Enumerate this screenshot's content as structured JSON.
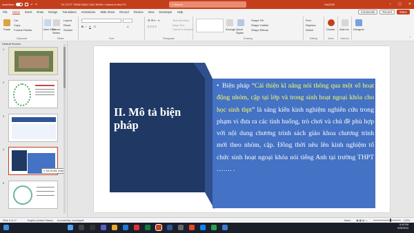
{
  "titlebar": {
    "autosave_label": "AutoSave",
    "toggle_state": "Off",
    "file_name": "TH CVTT TRINH BAO CAO SKKN • Saved to this PC",
    "search_placeholder": "Search",
    "user_name": "Hiu2220",
    "colors": {
      "accent": "#c43e1c"
    }
  },
  "tabs": [
    "File",
    "Home",
    "Insert",
    "Draw",
    "Design",
    "Transitions",
    "Animations",
    "Slide Show",
    "Record",
    "Review",
    "View",
    "Developer",
    "Help"
  ],
  "active_tab": "Home",
  "tab_actions": {
    "comments": "Comments",
    "record": "Record",
    "share": "Share"
  },
  "ribbon": {
    "clipboard": {
      "paste": "Paste",
      "cut": "Cut",
      "copy": "Copy",
      "format_painter": "Format Painter",
      "label": "Clipboard"
    },
    "slides": {
      "new_slide": "New Slide",
      "reuse_slides": "Reuse Slides",
      "layout": "Layout",
      "reset": "Reset",
      "section": "Section",
      "label": "Slides"
    },
    "font": {
      "label": "Font"
    },
    "paragraph": {
      "label": "Paragraph",
      "convert_smartart": "Convert to SmartArt",
      "align_text": "Align Text",
      "text_direction": "Text Direction"
    },
    "drawing": {
      "label": "Drawing",
      "arrange": "Arrange",
      "quick_styles": "Quick Styles",
      "shape_fill": "Shape Fill",
      "shape_outline": "Shape Outline",
      "shape_effects": "Shape Effects"
    },
    "editing": {
      "label": "Editing",
      "find": "Find",
      "replace": "Replace",
      "select": "Select"
    },
    "voice": {
      "dictate": "Dictate",
      "label": "Voice"
    },
    "addins": {
      "addins": "Add-ins",
      "label": "Add-ins"
    },
    "designer": {
      "designer": "Designer"
    }
  },
  "sidebar": {
    "section_title": "Default Section",
    "slide_numbers": [
      "1",
      "2",
      "3",
      "4",
      "5"
    ],
    "tooltip": "II. Mô tả biện pháp"
  },
  "slide": {
    "title": "II. Mô tả biện pháp",
    "bullet": "•",
    "body_intro": "Biện pháp “",
    "body_highlight": "Cải thiện kĩ năng nói thông qua một số hoạt động nhóm, cặp tại lớp và trong sinh hoạt ngoại khóa cho học sinh thpt",
    "body_rest": "” là sáng kiến kinh nghiệm nghiên cứu trong phạm vi đưa ra các tình huống, trò chơi và chủ đề phù hợp với nội dung chương trình sách giáo khoa chương trình mới theo nhóm, cặp. Đồng thời nêu lên kinh nghiệm tổ chức sinh hoạt ngoại khóa nói tiếng Anh tại trường THPT ……. .",
    "colors": {
      "navy": "#1f3864",
      "blue": "#4472c4",
      "highlight": "#ffff66"
    }
  },
  "statusbar": {
    "slide_counter": "Slide 4 of 17",
    "language": "English (United States)",
    "accessibility": "Accessibility: Investigate",
    "notes": "Notes",
    "zoom": "100%"
  },
  "taskbar": {
    "time": "5:40 PM",
    "date": "6/29/2024"
  }
}
